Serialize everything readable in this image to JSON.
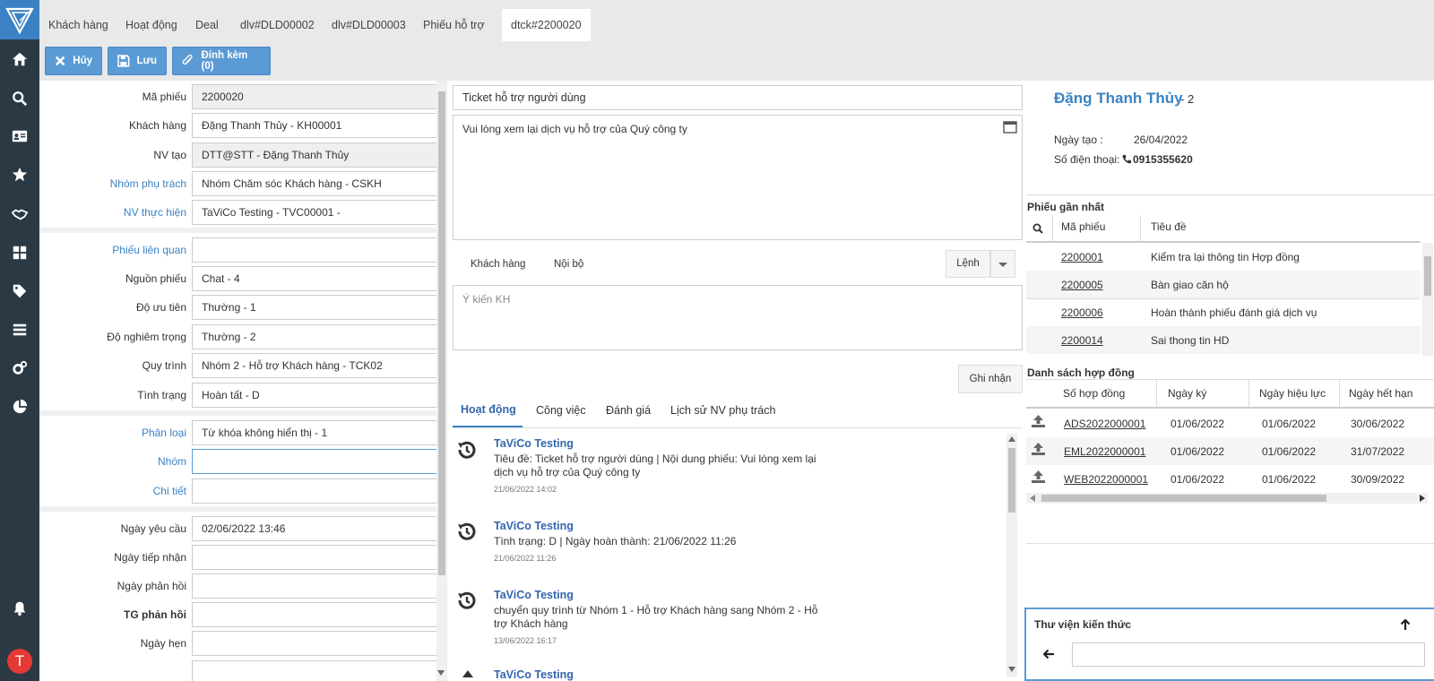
{
  "tabs": [
    "Khách hàng",
    "Hoạt động",
    "Deal",
    "dlv#DLD00002",
    "dlv#DLD00003",
    "Phiếu hỗ trợ",
    "dtck#2200020"
  ],
  "toolbar": {
    "cancel": "Hủy",
    "save": "Lưu",
    "attach": "Đính kèm (0)"
  },
  "form": {
    "ma_phieu": {
      "label": "Mã phiếu",
      "value": "2200020"
    },
    "khach_hang": {
      "label": "Khách hàng",
      "value": "Đặng Thanh Thủy - KH00001"
    },
    "nv_tao": {
      "label": "NV tạo",
      "value": "DTT@STT - Đặng Thanh Thủy"
    },
    "nhom_phu_trach": {
      "label": "Nhóm phụ trách",
      "value": "Nhóm Chăm sóc Khách hàng - CSKH"
    },
    "nv_thuc_hien": {
      "label": "NV thực hiện",
      "value": "TaViCo Testing - TVC00001 -"
    },
    "phieu_lien_quan": {
      "label": "Phiếu liên quan",
      "value": ""
    },
    "nguon_phieu": {
      "label": "Nguồn phiếu",
      "value": "Chat - 4"
    },
    "do_uu_tien": {
      "label": "Độ ưu tiên",
      "value": "Thường - 1"
    },
    "do_nghiem_trong": {
      "label": "Độ nghiêm trọng",
      "value": "Thường - 2"
    },
    "quy_trinh": {
      "label": "Quy trình",
      "value": "Nhóm 2 - Hỗ trợ Khách hàng - TCK02"
    },
    "tinh_trang": {
      "label": "Tình trạng",
      "value": "Hoàn tất - D"
    },
    "phan_loai": {
      "label": "Phân loại",
      "value": "Từ khóa không hiển thị - 1"
    },
    "nhom": {
      "label": "Nhóm",
      "value": ""
    },
    "chi_tiet": {
      "label": "Chi tiết",
      "value": ""
    },
    "ngay_yeu_cau": {
      "label": "Ngày yêu cầu",
      "value": "02/06/2022 13:46"
    },
    "ngay_tiep_nhan": {
      "label": "Ngày tiếp nhận",
      "value": ""
    },
    "ngay_phan_hoi": {
      "label": "Ngày phản hồi",
      "value": ""
    },
    "tg_phan_hoi": {
      "label": "TG phản hồi",
      "value": ""
    },
    "ngay_hen": {
      "label": "Ngày hẹn",
      "value": ""
    }
  },
  "ticket": {
    "subject": "Ticket hỗ trợ người dùng",
    "body": "Vui lòng xem lại dịch vụ hỗ trợ của Quý công ty",
    "tab_customer": "Khách hàng",
    "tab_internal": "Nội bộ",
    "command": "Lệnh",
    "comment_placeholder": "Ý kiến KH",
    "submit": "Ghi nhận"
  },
  "activity_tabs": [
    "Hoạt động",
    "Công việc",
    "Đánh giá",
    "Lịch sử NV phụ trách"
  ],
  "activities": [
    {
      "name": "TaViCo Testing",
      "text": "Tiêu đề: Ticket hỗ trợ người dùng | Nội dung phiếu: Vui lòng xem lại dịch vụ hỗ trợ của Quý công ty",
      "time": "21/06/2022 14:02"
    },
    {
      "name": "TaViCo Testing",
      "text": "Tình trạng: D | Ngày hoàn thành: 21/06/2022 11:26",
      "time": "21/06/2022 11:26"
    },
    {
      "name": "TaViCo Testing",
      "text": "chuyển quy trình từ Nhóm 1 - Hỗ trợ Khách hàng sang Nhóm 2 - Hỗ trợ Khách hàng",
      "time": "13/06/2022 16:17"
    },
    {
      "name": "TaViCo Testing",
      "text": "",
      "time": ""
    }
  ],
  "customer": {
    "name": "Đặng Thanh Thủy",
    "suffix": "- 2",
    "created_label": "Ngày tạo :",
    "created": "26/04/2022",
    "phone_label": "Số điện thoại:",
    "phone": "0915355620"
  },
  "recent_tickets": {
    "title": "Phiếu gần nhất",
    "headers": [
      "Mã phiếu",
      "Tiêu đề"
    ],
    "rows": [
      {
        "id": "2200001",
        "title": "Kiểm tra lại thông tin Hợp đồng"
      },
      {
        "id": "2200005",
        "title": "Bàn giao căn hộ"
      },
      {
        "id": "2200006",
        "title": "Hoàn thành phiếu đánh giá dịch vụ"
      },
      {
        "id": "2200014",
        "title": "Sai thong tin HD"
      }
    ]
  },
  "contracts": {
    "title": "Danh sách hợp đồng",
    "headers": [
      "Số hợp đồng",
      "Ngày ký",
      "Ngày hiệu lực",
      "Ngày hết hạn"
    ],
    "rows": [
      {
        "no": "ADS2022000001",
        "signed": "01/06/2022",
        "effective": "01/06/2022",
        "expire": "30/06/2022"
      },
      {
        "no": "EML2022000001",
        "signed": "01/06/2022",
        "effective": "01/06/2022",
        "expire": "31/07/2022"
      },
      {
        "no": "WEB2022000001",
        "signed": "01/06/2022",
        "effective": "01/06/2022",
        "expire": "30/09/2022"
      }
    ]
  },
  "knowledge": {
    "title": "Thư viện kiến thức",
    "placeholder": ""
  },
  "avatar_letter": "T",
  "colors": {
    "sidebar": "#2b3944",
    "accent": "#3b82c4",
    "button": "#5b9bd5",
    "avatar": "#e53935"
  }
}
